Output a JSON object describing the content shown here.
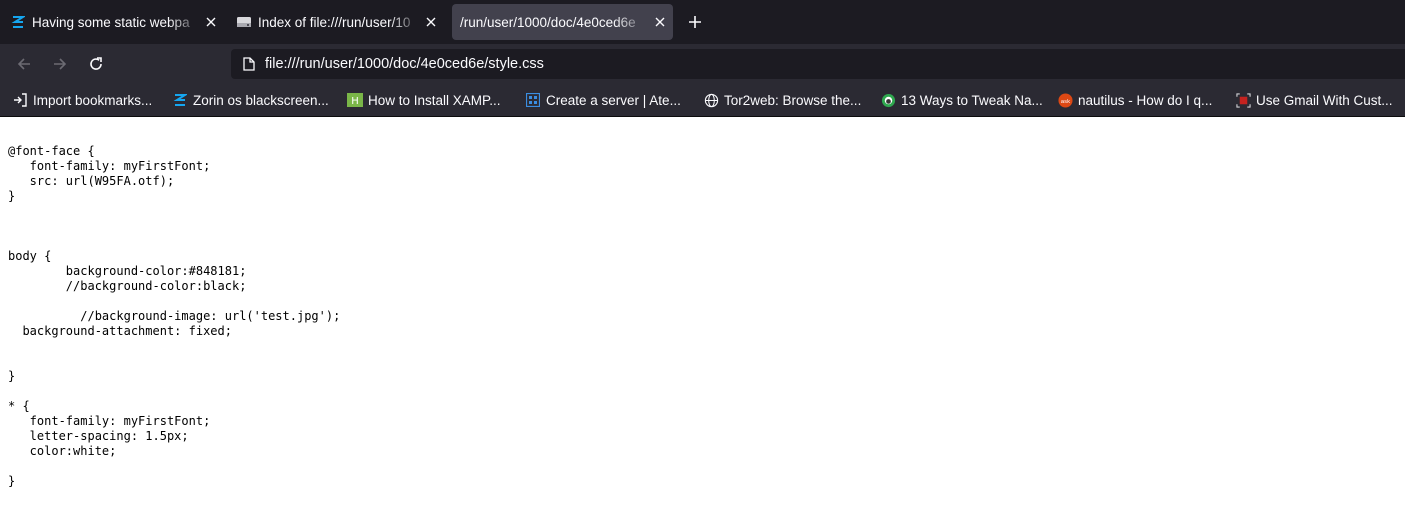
{
  "browser": {
    "tabs": [
      {
        "title": "Having some static webpa",
        "icon": "zorin-logo-icon"
      },
      {
        "title": "Index of file:///run/user/10",
        "icon": "drive-icon"
      },
      {
        "title": "/run/user/1000/doc/4e0ced6e",
        "icon": "none",
        "active": true
      }
    ],
    "new_tab_label": "+",
    "url": "file:///run/user/1000/doc/4e0ced6e/style.css",
    "bookmarks": [
      {
        "label": "Import bookmarks...",
        "icon": "import-icon"
      },
      {
        "label": "Zorin os blackscreen...",
        "icon": "zorin-logo-icon"
      },
      {
        "label": "How to Install XAMP...",
        "icon": "xampp-icon"
      },
      {
        "label": "Create a server | Ate...",
        "icon": "server-icon"
      },
      {
        "label": "Tor2web: Browse the...",
        "icon": "globe-icon"
      },
      {
        "label": "13 Ways to Tweak Na...",
        "icon": "site-icon"
      },
      {
        "label": "nautilus - How do I q...",
        "icon": "askubuntu-icon"
      },
      {
        "label": "Use Gmail With Cust...",
        "icon": "gmail-icon"
      }
    ]
  },
  "page": {
    "css_source": "@font-face {\n   font-family: myFirstFont;\n   src: url(W95FA.otf);\n}\n\n\n\nbody {\n        background-color:#848181;\n        //background-color:black;\n\n          //background-image: url('test.jpg');\n  background-attachment: fixed;\n\n\n}\n\n* {\n   font-family: myFirstFont;\n   letter-spacing: 1.5px;\n   color:white;\n\n}"
  },
  "colors": {
    "tabstrip_bg": "#1c1b22",
    "toolbar_bg": "#2b2a33",
    "active_tab_bg": "#42414d",
    "text": "#fbfbfe"
  }
}
